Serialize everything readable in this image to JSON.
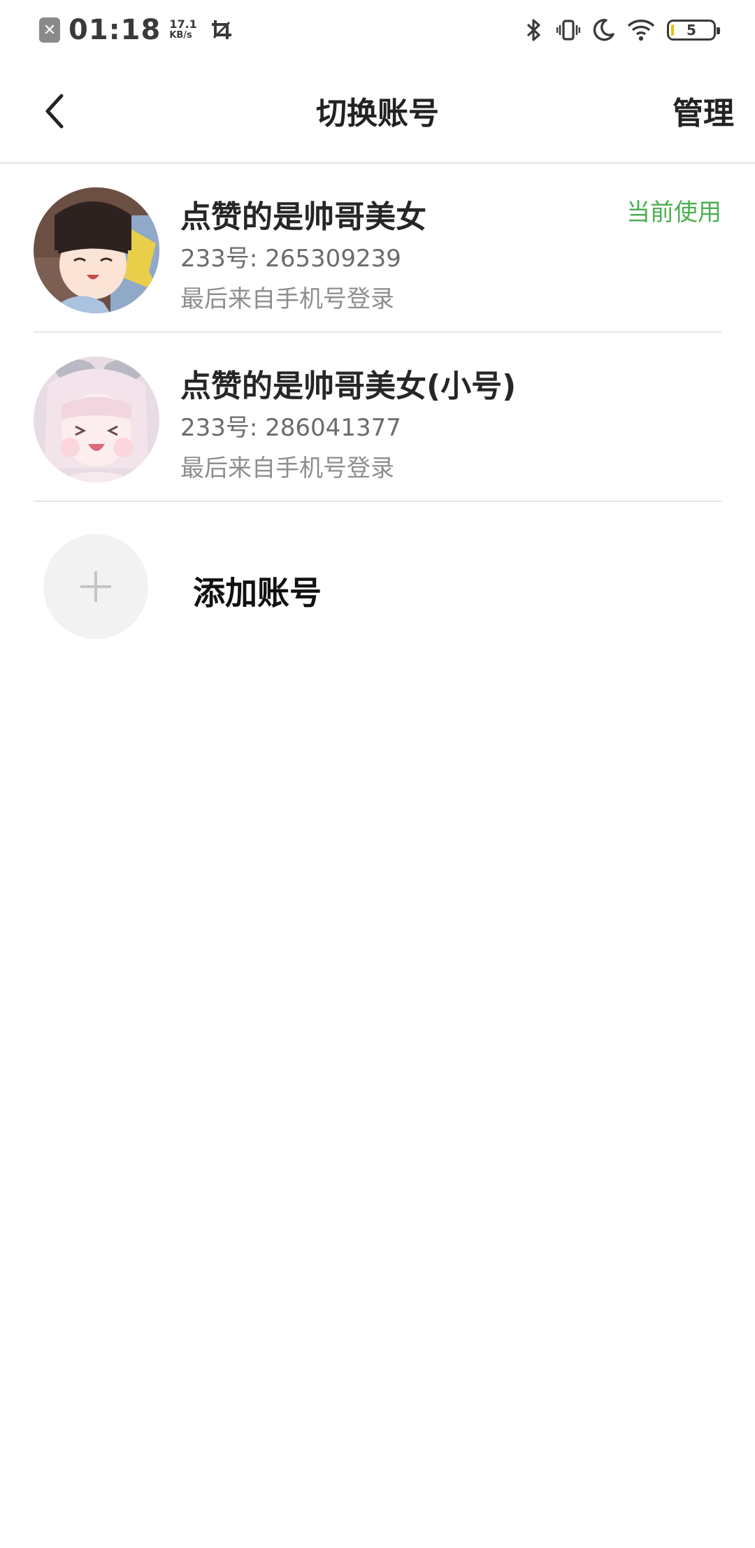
{
  "status_bar": {
    "time": "01:18",
    "speed_value": "17.1",
    "speed_unit": "KB/s",
    "battery_level": "5",
    "icons": [
      "close-notification-icon",
      "screenshot-crop-icon",
      "bluetooth-icon",
      "vibrate-icon",
      "do-not-disturb-moon-icon",
      "wifi-icon",
      "battery-icon"
    ]
  },
  "navbar": {
    "title": "切换账号",
    "manage_label": "管理",
    "back_icon": "chevron-left-icon"
  },
  "accounts": [
    {
      "name": "点赞的是帅哥美女",
      "id_line": "233号: 265309239",
      "login_line": "最后来自手机号登录",
      "current_label": "当前使用"
    },
    {
      "name": "点赞的是帅哥美女(小号)",
      "id_line": "233号: 286041377",
      "login_line": "最后来自手机号登录"
    }
  ],
  "add_account": {
    "label": "添加账号",
    "icon": "plus-icon"
  },
  "colors": {
    "accent_green": "#4caf50",
    "divider": "#e6e6e6",
    "add_circle_bg": "#f2f2f2"
  }
}
